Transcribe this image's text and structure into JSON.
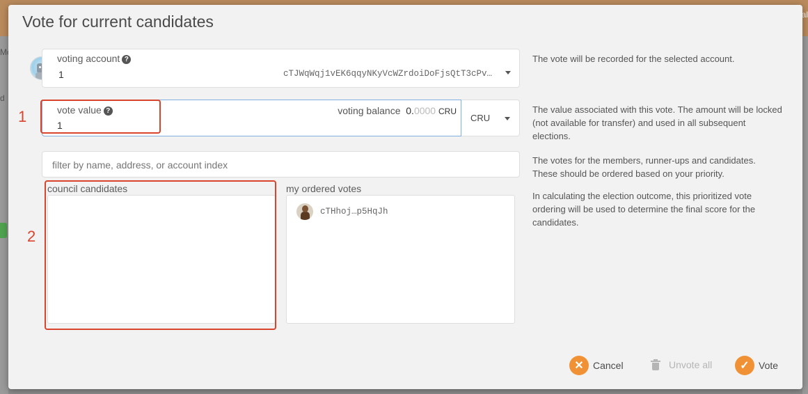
{
  "backdrop": {
    "left_text_1": "Mo",
    "left_text_2": "d",
    "right_text": "al"
  },
  "modal": {
    "title": "Vote for current candidates"
  },
  "voting_account": {
    "label": "voting account",
    "name": "1",
    "address": "cTJWqWqj1vEK6qqyNKyVcWZrdoiDoFjsQtT3cPv…",
    "description": "The vote will be recorded for the selected account."
  },
  "vote_value": {
    "label": "vote value",
    "value": "1",
    "balance_label": "voting balance",
    "balance_int": "0.",
    "balance_dec": "0000",
    "balance_unit": "CRU",
    "unit_select": "CRU",
    "description": "The value associated with this vote. The amount will be locked (not available for transfer) and used in all subsequent elections."
  },
  "filter": {
    "placeholder": "filter by name, address, or account index",
    "description": "The votes for the members, runner-ups and candidates. These should be ordered based on your priority."
  },
  "candidates": {
    "label": "council candidates"
  },
  "ordered_votes": {
    "label": "my ordered votes",
    "items": [
      {
        "address": "cTHhoj…p5HqJh"
      }
    ],
    "description": "In calculating the election outcome, this prioritized vote ordering will be used to determine the final score for the candidates."
  },
  "annotations": {
    "one": "1",
    "two": "2"
  },
  "actions": {
    "cancel": "Cancel",
    "unvote": "Unvote all",
    "vote": "Vote"
  },
  "colors": {
    "accent": "#f19135",
    "annotation": "#d9442d"
  }
}
